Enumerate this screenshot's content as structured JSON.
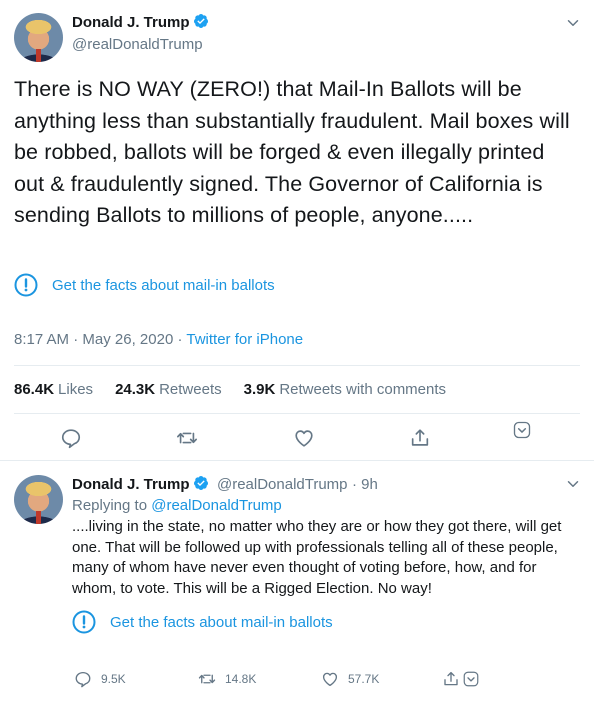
{
  "main_tweet": {
    "author_name": "Donald J. Trump",
    "handle": "@realDonaldTrump",
    "text": "There is NO WAY (ZERO!) that Mail-In Ballots will be anything less than substantially fraudulent. Mail boxes will be robbed, ballots will be forged & even illegally printed out & fraudulently signed. The Governor of California is sending Ballots to millions of people, anyone.....",
    "facts_label": "Get the facts about mail-in ballots",
    "time": "8:17 AM",
    "date": "May 26, 2020",
    "separator": "·",
    "source": "Twitter for iPhone",
    "stats": {
      "likes_count": "86.4K",
      "likes_label": "Likes",
      "retweets_count": "24.3K",
      "retweets_label": "Retweets",
      "comments_count": "3.9K",
      "comments_label": "Retweets with comments"
    }
  },
  "reply_tweet": {
    "author_name": "Donald J. Trump",
    "handle": "@realDonaldTrump",
    "age": "· 9h",
    "replying_to_label": "Replying to",
    "replying_to_handle": "@realDonaldTrump",
    "text": "....living in the state, no matter who they are or how they got there, will get one. That will be followed up with professionals telling all of these people, many of whom have never even thought of voting before, how, and for whom, to vote. This will be a Rigged Election. No way!",
    "facts_label": "Get the facts about mail-in ballots",
    "reply_count": "9.5K",
    "retweet_count": "14.8K",
    "like_count": "57.7K"
  },
  "icons": {
    "verified": "verified-badge-icon",
    "chevron": "chevron-down-icon",
    "info": "exclamation-circle-icon",
    "reply": "speech-bubble-icon",
    "retweet": "retweet-arrows-icon",
    "like": "heart-icon",
    "share": "share-upload-icon",
    "more": "chevron-down-box-icon"
  },
  "colors": {
    "accent": "#1b95e0",
    "verified": "#1da1f2",
    "text": "#14171a",
    "muted": "#657786",
    "divider": "#e6ecf0"
  }
}
